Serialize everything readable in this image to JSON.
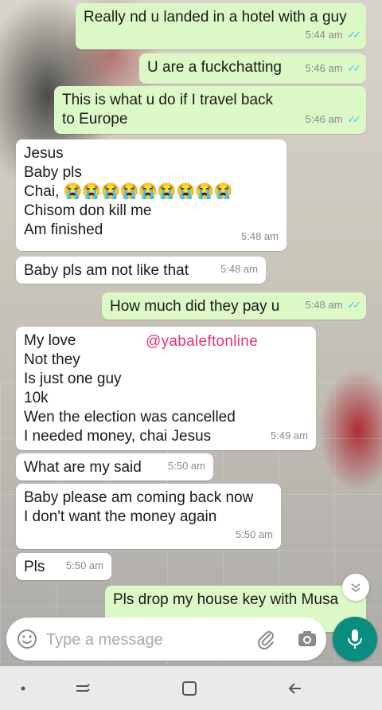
{
  "colors": {
    "outgoing_bubble": "#dcf8c6",
    "incoming_bubble": "#ffffff",
    "read_ticks": "#4fc3f7",
    "watermark": "#e8356b",
    "mic_button": "#0a8d7e"
  },
  "messages": [
    {
      "dir": "out",
      "text": "Really nd u landed in a hotel with a guy",
      "time": "5:44 am",
      "status": "read"
    },
    {
      "dir": "out",
      "text": "U are a fuckchatting",
      "time": "5:46 am",
      "status": "read"
    },
    {
      "dir": "out",
      "text": "This is what u do if I travel back\nto Europe",
      "time": "5:46 am",
      "status": "read"
    },
    {
      "dir": "in",
      "text": "Jesus\nBaby pls\nChai, 😭😭😭😭😭😭😭😭😭\nChisom don kill me\nAm finished",
      "time": "5:48 am"
    },
    {
      "dir": "in",
      "text": "Baby pls am not like that",
      "time": "5:48 am"
    },
    {
      "dir": "out",
      "text": "How much did they pay u",
      "time": "5:48 am",
      "status": "read"
    },
    {
      "dir": "in",
      "text": "My love\nNot they\nIs just one guy\n10k\nWen the election was cancelled\nI needed money,  chai Jesus",
      "time": "5:49 am"
    },
    {
      "dir": "in",
      "text": "What are my said",
      "time": "5:50 am"
    },
    {
      "dir": "in",
      "text": "Baby please am coming back now\nI don't want the money again",
      "time": "5:50 am"
    },
    {
      "dir": "in",
      "text": "Pls",
      "time": "5:50 am"
    },
    {
      "dir": "out",
      "text": "Pls drop my house key with Musa",
      "time": "",
      "status": ""
    }
  ],
  "watermark": "@yabaleftonline",
  "composer": {
    "placeholder": "Type a message",
    "emoji_icon": "emoji-icon",
    "attach_icon": "paperclip-icon",
    "camera_icon": "camera-icon",
    "mic_icon": "microphone-icon"
  },
  "navigation": [
    "dot-icon",
    "recents-icon",
    "home-icon",
    "back-icon"
  ]
}
